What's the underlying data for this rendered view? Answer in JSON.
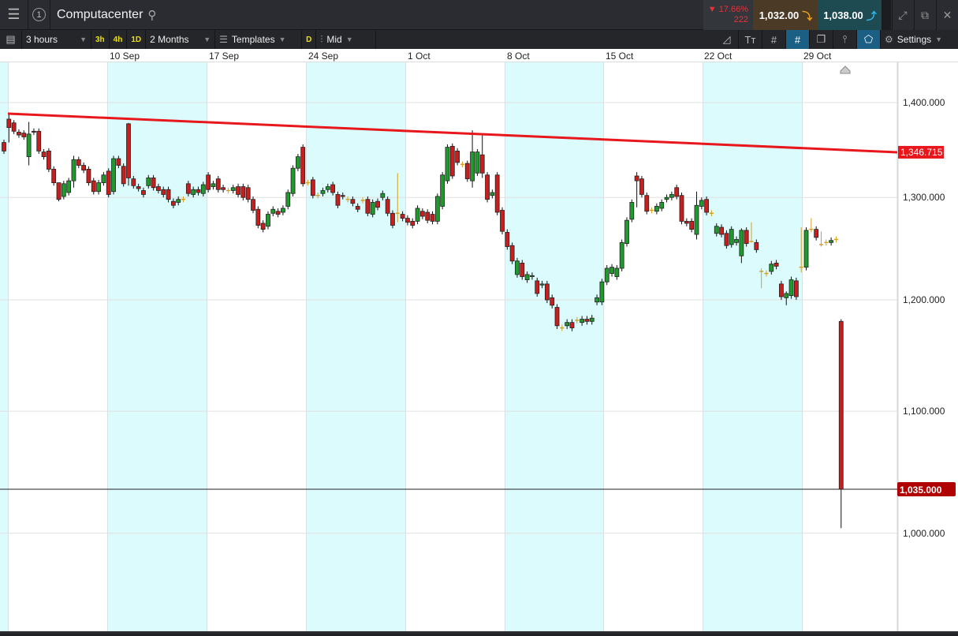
{
  "header": {
    "instrument": "Computacenter",
    "window_number": "1",
    "change_pct": "17.66%",
    "change_abs": "222",
    "bid": "1,032.00",
    "ask": "1,038.00"
  },
  "toolbar": {
    "interval": "3 hours",
    "quick_intervals": [
      "3h",
      "4h",
      "1D"
    ],
    "range": "2 Months",
    "templates": "Templates",
    "d_label": "D",
    "price_type": "Mid",
    "settings": "Settings"
  },
  "colors": {
    "up": "#1f9a2c",
    "down": "#c81e1e",
    "doji": "#d4a020",
    "trendline": "#e8171c",
    "band": "#dcfbfd",
    "last_price_bg": "#b00000"
  },
  "chart_data": {
    "type": "candlestick",
    "x_tick_labels": [
      "10 Sep",
      "17 Sep",
      "24 Sep",
      "1 Oct",
      "8 Oct",
      "15 Oct",
      "22 Oct",
      "29 Oct"
    ],
    "y_tick_labels": [
      "1,400.000",
      "1,300.000",
      "1,200.000",
      "1,100.000",
      "1,000.000"
    ],
    "y_ticks": [
      1400,
      1300,
      1200,
      1100,
      1000
    ],
    "y_scale": "log",
    "trendline": {
      "start": 1388,
      "end": 1346.715,
      "label": "1,346.715"
    },
    "last_price": {
      "value": 1035,
      "label": "1,035.000"
    },
    "candles_oc_hl": [
      [
        1357,
        1348
      ],
      [
        1382,
        1373,
        1388,
        1357
      ],
      [
        1378,
        1369
      ],
      [
        1368,
        1365
      ],
      [
        1367,
        1363
      ],
      [
        1342,
        1366,
        1379,
        1333
      ],
      [
        1369,
        1368
      ],
      [
        1369,
        1348
      ],
      [
        1347,
        1342
      ],
      [
        1348,
        1329
      ],
      [
        1329,
        1315
      ],
      [
        1315,
        1298,
        1315,
        1296
      ],
      [
        1301,
        1314
      ],
      [
        1305,
        1317
      ],
      [
        1317,
        1339,
        1343,
        1310
      ],
      [
        1339,
        1333
      ],
      [
        1333,
        1328
      ],
      [
        1329,
        1315
      ],
      [
        1317,
        1306
      ],
      [
        1306,
        1315
      ],
      [
        1315,
        1323
      ],
      [
        1327,
        1303
      ],
      [
        1306,
        1340
      ],
      [
        1340,
        1333
      ],
      [
        1332,
        1314
      ],
      [
        1377,
        1320,
        1378,
        1312
      ],
      [
        1319,
        1312
      ],
      [
        1311,
        1309
      ],
      [
        1307,
        1303
      ],
      [
        1312,
        1320
      ],
      [
        1320,
        1310
      ],
      [
        1311,
        1307
      ],
      [
        1308,
        1303
      ],
      [
        1308,
        1298
      ],
      [
        1296,
        1292
      ],
      [
        1295,
        1298
      ],
      [
        1298,
        1298
      ],
      [
        1314,
        1304
      ],
      [
        1303,
        1308
      ],
      [
        1308,
        1305
      ],
      [
        1304,
        1313
      ],
      [
        1323,
        1308
      ],
      [
        1311,
        1314
      ],
      [
        1319,
        1308
      ],
      [
        1310,
        1308
      ],
      [
        1307,
        1307
      ],
      [
        1307,
        1310
      ],
      [
        1311,
        1303
      ],
      [
        1311,
        1300
      ],
      [
        1310,
        1298
      ],
      [
        1298,
        1287
      ],
      [
        1288,
        1272
      ],
      [
        1274,
        1268
      ],
      [
        1271,
        1283
      ],
      [
        1284,
        1288
      ],
      [
        1286,
        1283
      ],
      [
        1285,
        1289
      ],
      [
        1291,
        1305
      ],
      [
        1304,
        1330
      ],
      [
        1330,
        1342
      ],
      [
        1352,
        1314
      ],
      [
        1315,
        1315
      ],
      [
        1318,
        1302
      ],
      [
        1302,
        1302
      ],
      [
        1304,
        1307
      ],
      [
        1308,
        1311
      ],
      [
        1313,
        1305
      ],
      [
        1303,
        1292
      ],
      [
        1302,
        1301
      ],
      [
        1298,
        1298
      ],
      [
        1298,
        1294
      ],
      [
        1291,
        1288
      ],
      [
        1297,
        1297
      ],
      [
        1298,
        1284
      ],
      [
        1283,
        1295
      ],
      [
        1296,
        1290
      ],
      [
        1300,
        1304
      ],
      [
        1298,
        1284
      ],
      [
        1284,
        1272
      ],
      [
        1284,
        1284,
        1325,
        1275
      ],
      [
        1283,
        1279
      ],
      [
        1279,
        1275
      ],
      [
        1276,
        1272
      ],
      [
        1276,
        1289
      ],
      [
        1286,
        1281
      ],
      [
        1285,
        1277
      ],
      [
        1283,
        1276
      ],
      [
        1276,
        1301
      ],
      [
        1291,
        1323
      ],
      [
        1317,
        1352
      ],
      [
        1353,
        1322
      ],
      [
        1348,
        1336
      ],
      [
        1334,
        1334
      ],
      [
        1335,
        1319
      ],
      [
        1317,
        1347,
        1370,
        1310
      ],
      [
        1325,
        1347
      ],
      [
        1344,
        1325,
        1366,
        1320
      ],
      [
        1323,
        1298
      ],
      [
        1302,
        1305
      ],
      [
        1323,
        1285
      ],
      [
        1287,
        1266
      ],
      [
        1265,
        1251
      ],
      [
        1252,
        1237
      ],
      [
        1224,
        1237
      ],
      [
        1235,
        1222
      ],
      [
        1219,
        1224
      ],
      [
        1222,
        1223
      ],
      [
        1218,
        1206
      ],
      [
        1214,
        1215
      ],
      [
        1215,
        1200
      ],
      [
        1202,
        1195
      ],
      [
        1193,
        1176
      ],
      [
        1174,
        1174
      ],
      [
        1176,
        1179
      ],
      [
        1179,
        1174
      ],
      [
        1181,
        1181
      ],
      [
        1179,
        1182
      ],
      [
        1182,
        1180
      ],
      [
        1180,
        1183
      ],
      [
        1198,
        1202
      ],
      [
        1198,
        1217
      ],
      [
        1217,
        1230
      ],
      [
        1225,
        1231
      ],
      [
        1222,
        1230
      ],
      [
        1230,
        1255
      ],
      [
        1254,
        1277
      ],
      [
        1278,
        1295
      ],
      [
        1322,
        1317,
        1326,
        1290
      ],
      [
        1319,
        1303
      ],
      [
        1302,
        1286
      ],
      [
        1287,
        1287
      ],
      [
        1286,
        1291
      ],
      [
        1289,
        1295
      ],
      [
        1298,
        1300
      ],
      [
        1300,
        1303
      ],
      [
        1310,
        1301
      ],
      [
        1302,
        1276
      ],
      [
        1276,
        1274
      ],
      [
        1276,
        1268
      ],
      [
        1263,
        1292,
        1306,
        1258
      ],
      [
        1291,
        1297
      ],
      [
        1298,
        1285
      ],
      [
        1284,
        1284
      ],
      [
        1264,
        1271
      ],
      [
        1270,
        1263
      ],
      [
        1264,
        1252
      ],
      [
        1253,
        1268
      ],
      [
        1255,
        1258
      ],
      [
        1242,
        1267,
        1269,
        1235
      ],
      [
        1267,
        1254
      ],
      [
        1256,
        1256,
        1275,
        1255
      ],
      [
        1255,
        1248
      ],
      [
        1227,
        1227,
        1230,
        1211
      ],
      [
        1225,
        1225
      ],
      [
        1227,
        1234
      ],
      [
        1235,
        1232
      ],
      [
        1215,
        1203
      ],
      [
        1202,
        1206,
        1208,
        1195
      ],
      [
        1204,
        1219
      ],
      [
        1218,
        1203
      ],
      [
        1231,
        1231,
        1270,
        1226
      ],
      [
        1231,
        1267
      ],
      [
        1268,
        1268,
        1279,
        1265
      ],
      [
        1268,
        1260
      ],
      [
        1253,
        1253,
        1266,
        1251
      ],
      [
        1255,
        1255
      ],
      [
        1255,
        1257
      ],
      [
        1258,
        1258
      ],
      [
        1180,
        1035,
        1182,
        1004
      ]
    ]
  }
}
